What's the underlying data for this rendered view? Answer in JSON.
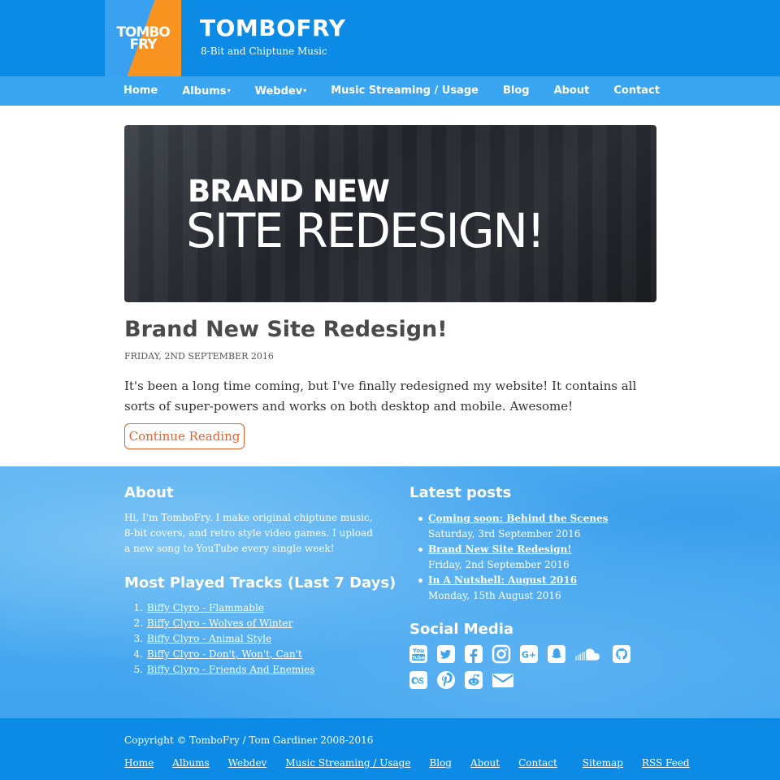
{
  "header": {
    "logo_text_1": "TOMBO",
    "logo_text_2": "FRY",
    "title": "TOMBOFRY",
    "tagline": "8-Bit and Chiptune Music"
  },
  "nav": {
    "items": [
      {
        "label": "Home",
        "dropdown": false
      },
      {
        "label": "Albums",
        "dropdown": true
      },
      {
        "label": "Webdev",
        "dropdown": true
      },
      {
        "label": "Music Streaming / Usage",
        "dropdown": false
      },
      {
        "label": "Blog",
        "dropdown": false
      },
      {
        "label": "About",
        "dropdown": false
      },
      {
        "label": "Contact",
        "dropdown": false
      }
    ]
  },
  "hero": {
    "line1": "BRAND NEW",
    "line2": "SITE REDESIGN!"
  },
  "post": {
    "title": "Brand New Site Redesign!",
    "date": "FRIDAY, 2ND SEPTEMBER 2016",
    "excerpt": "It's been a long time coming, but I've finally redesigned my website! It contains all sorts of super-powers and works on both desktop and mobile. Awesome!",
    "continue_label": "Continue Reading"
  },
  "about": {
    "heading": "About",
    "text": "Hi, I'm TomboFry. I make original chiptune music, 8-bit covers, and retro style video games. I upload a new song to YouTube every single week!"
  },
  "tracks": {
    "heading": "Most Played Tracks (Last 7 Days)",
    "items": [
      {
        "num": "1.",
        "label": "Biffy Clyro - Flammable"
      },
      {
        "num": "2.",
        "label": "Biffy Clyro - Wolves of Winter"
      },
      {
        "num": "3.",
        "label": "Biffy Clyro - Animal Style"
      },
      {
        "num": "4.",
        "label": "Biffy Clyro - Don't, Won't, Can't"
      },
      {
        "num": "5.",
        "label": "Biffy Clyro - Friends And Enemies"
      }
    ]
  },
  "latest": {
    "heading": "Latest posts",
    "items": [
      {
        "title": "Coming soon: Behind the Scenes",
        "date": "Saturday, 3rd September 2016"
      },
      {
        "title": "Brand New Site Redesign!",
        "date": "Friday, 2nd September 2016"
      },
      {
        "title": "In A Nutshell: August 2016",
        "date": "Monday, 15th August 2016"
      }
    ]
  },
  "social": {
    "heading": "Social Media",
    "icons": [
      "youtube-icon",
      "twitter-icon",
      "facebook-icon",
      "instagram-icon",
      "google-plus-icon",
      "snapchat-icon",
      "soundcloud-icon",
      "github-icon",
      "lastfm-icon",
      "pinterest-icon",
      "reddit-icon",
      "email-icon"
    ],
    "youtube_text_1": "You",
    "youtube_text_2": "Tube",
    "googleplus_text": "G+"
  },
  "footer": {
    "copyright": "Copyright © TomboFry / Tom Gardiner 2008-2016",
    "links": [
      "Home",
      "Albums",
      "Webdev",
      "Music Streaming / Usage",
      "Blog",
      "About",
      "Contact",
      "Sitemap",
      "RSS Feed"
    ]
  },
  "colors": {
    "header_blue": "#0b8ae6",
    "nav_blue": "#3aa6f2",
    "accent_orange": "#e8602c",
    "logo_orange": "#f7931e"
  }
}
